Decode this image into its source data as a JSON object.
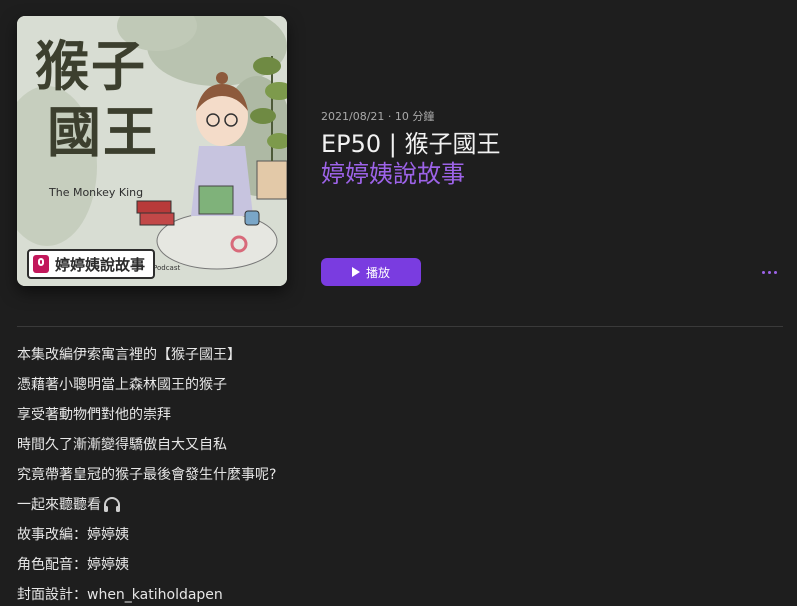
{
  "artwork": {
    "title_line1": "猴子",
    "title_line2": "國王",
    "subtitle": "The Monkey King",
    "badge_text": "婷婷姨說故事",
    "badge_sub": "Podcast"
  },
  "episode": {
    "meta": "2021/08/21 · 10 分鐘",
    "title": "EP50 | 猴子國王",
    "show": "婷婷姨說故事"
  },
  "actions": {
    "play_label": "播放",
    "more_icon": "ellipsis-icon"
  },
  "colors": {
    "accent": "#9d63e8",
    "button": "#7a3ce0",
    "background": "#1e1e1e"
  },
  "description": {
    "lines": [
      "本集改編伊索寓言裡的【猴子國王】",
      "憑藉著小聰明當上森林國王的猴子",
      "享受著動物們對他的崇拜",
      "時間久了漸漸變得驕傲自大又自私",
      "究竟帶著皇冠的猴子最後會發生什麼事呢?",
      "一起來聽聽看",
      "故事改編：婷婷姨",
      "角色配音：婷婷姨",
      "封面設計：when_katiholdapen"
    ],
    "headphone_icon": "headphones-icon"
  }
}
